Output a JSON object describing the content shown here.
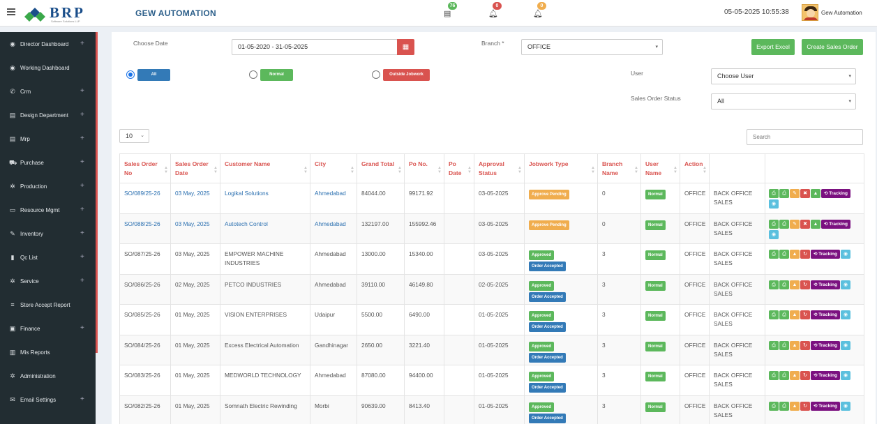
{
  "header": {
    "logo_text": "BRP",
    "logo_sub": "Software Solutions LLP",
    "app_title": "GEW AUTOMATION",
    "notifications": [
      {
        "icon": "message-icon",
        "count": "76",
        "color": "#5cb85c"
      },
      {
        "icon": "bell-icon",
        "count": "0",
        "color": "#d9534f"
      },
      {
        "icon": "bell-icon",
        "count": "0",
        "color": "#f0ad4e"
      }
    ],
    "datetime": "05-05-2025 10:55:38",
    "user_name": "Gew Automation"
  },
  "sidebar": {
    "items": [
      {
        "label": "Director Dashboard",
        "icon": "dashboard-icon",
        "expandable": true
      },
      {
        "label": "Working Dashboard",
        "icon": "dashboard-icon",
        "expandable": false
      },
      {
        "label": "Crm",
        "icon": "phone-icon",
        "expandable": true
      },
      {
        "label": "Design Department",
        "icon": "table-icon",
        "expandable": true
      },
      {
        "label": "Mrp",
        "icon": "table-icon",
        "expandable": true
      },
      {
        "label": "Purchase",
        "icon": "cart-icon",
        "expandable": true
      },
      {
        "label": "Production",
        "icon": "gear-icon",
        "expandable": true
      },
      {
        "label": "Resource Mgmt",
        "icon": "server-icon",
        "expandable": true
      },
      {
        "label": "Inventory",
        "icon": "wrench-icon",
        "expandable": true
      },
      {
        "label": "Qc List",
        "icon": "file-icon",
        "expandable": true
      },
      {
        "label": "Service",
        "icon": "gear-icon",
        "expandable": true
      },
      {
        "label": "Store Accept Report",
        "icon": "list-icon",
        "expandable": false
      },
      {
        "label": "Finance",
        "icon": "money-icon",
        "expandable": true
      },
      {
        "label": "Mis Reports",
        "icon": "bar-chart-icon",
        "expandable": false
      },
      {
        "label": "Administration",
        "icon": "gear-icon",
        "expandable": false
      },
      {
        "label": "Email Settings",
        "icon": "envelope-icon",
        "expandable": true
      }
    ]
  },
  "filters": {
    "choose_date_label": "Choose Date",
    "date_range": "01-05-2020 - 31-05-2025",
    "branch_label": "Branch *",
    "branch_value": "OFFICE",
    "export_label": "Export Excel",
    "create_label": "Create Sales Order",
    "radio_all": "All",
    "radio_normal": "Normal",
    "radio_outside": "Outside Jobwork",
    "user_label": "User",
    "user_value": "Choose User",
    "status_label": "Sales Order Status",
    "status_value": "All",
    "page_size": "10",
    "search_placeholder": "Search"
  },
  "table": {
    "headers": [
      "Sales Order No",
      "Sales Order Date",
      "Customer Name",
      "City",
      "Grand Total",
      "Po No.",
      "Po Date",
      "Approval Status",
      "Jobwork Type",
      "Branch Name",
      "User Name",
      "Action"
    ],
    "rows": [
      {
        "no": "SO/089/25-26",
        "date": "03 May, 2025",
        "customer": "Logikal Solutions",
        "city": "Ahmedabad",
        "total": "84044.00",
        "po_no": "99171.92",
        "po_date": "",
        "approval": "03-05-2025",
        "jobwork": [
          "Approve Pending"
        ],
        "branch": "0",
        "user": "Normal",
        "action": "OFFICE",
        "extra": "BACK OFFICE SALES",
        "pending": true
      },
      {
        "no": "SO/088/25-26",
        "date": "03 May, 2025",
        "customer": "Autotech Control",
        "city": "Ahmedabad",
        "total": "132197.00",
        "po_no": "155992.46",
        "po_date": "",
        "approval": "03-05-2025",
        "jobwork": [
          "Approve Pending"
        ],
        "branch": "0",
        "user": "Normal",
        "action": "OFFICE",
        "extra": "BACK OFFICE SALES",
        "pending": true
      },
      {
        "no": "SO/087/25-26",
        "date": "03 May, 2025",
        "customer": "EMPOWER MACHINE INDUSTRIES",
        "city": "Ahmedabad",
        "total": "13000.00",
        "po_no": "15340.00",
        "po_date": "",
        "approval": "03-05-2025",
        "jobwork": [
          "Approved",
          "Order Accepted"
        ],
        "branch": "3",
        "user": "Normal",
        "action": "OFFICE",
        "extra": "BACK OFFICE SALES",
        "pending": false
      },
      {
        "no": "SO/086/25-26",
        "date": "02 May, 2025",
        "customer": "PETCO INDUSTRIES",
        "city": "Ahmedabad",
        "total": "39110.00",
        "po_no": "46149.80",
        "po_date": "",
        "approval": "02-05-2025",
        "jobwork": [
          "Approved",
          "Order Accepted"
        ],
        "branch": "3",
        "user": "Normal",
        "action": "OFFICE",
        "extra": "BACK OFFICE SALES",
        "pending": false
      },
      {
        "no": "SO/085/25-26",
        "date": "01 May, 2025",
        "customer": "VISION ENTERPRISES",
        "city": "Udaipur",
        "total": "5500.00",
        "po_no": "6490.00",
        "po_date": "",
        "approval": "01-05-2025",
        "jobwork": [
          "Approved",
          "Order Accepted"
        ],
        "branch": "3",
        "user": "Normal",
        "action": "OFFICE",
        "extra": "BACK OFFICE SALES",
        "pending": false
      },
      {
        "no": "SO/084/25-26",
        "date": "01 May, 2025",
        "customer": "Excess Electrical Automation",
        "city": "Gandhinagar",
        "total": "2650.00",
        "po_no": "3221.40",
        "po_date": "",
        "approval": "01-05-2025",
        "jobwork": [
          "Approved",
          "Order Accepted"
        ],
        "branch": "3",
        "user": "Normal",
        "action": "OFFICE",
        "extra": "BACK OFFICE SALES",
        "pending": false
      },
      {
        "no": "SO/083/25-26",
        "date": "01 May, 2025",
        "customer": "MEDWORLD TECHNOLOGY",
        "city": "Ahmedabad",
        "total": "87080.00",
        "po_no": "94400.00",
        "po_date": "",
        "approval": "01-05-2025",
        "jobwork": [
          "Approved",
          "Order Accepted"
        ],
        "branch": "3",
        "user": "Normal",
        "action": "OFFICE",
        "extra": "BACK OFFICE SALES",
        "pending": false
      },
      {
        "no": "SO/082/25-26",
        "date": "01 May, 2025",
        "customer": "Somnath Electric Rewinding",
        "city": "Morbi",
        "total": "90639.00",
        "po_no": "8413.40",
        "po_date": "",
        "approval": "01-05-2025",
        "jobwork": [
          "Approved",
          "Order Accepted"
        ],
        "branch": "3",
        "user": "Normal",
        "action": "OFFICE",
        "extra": "BACK OFFICE SALES",
        "pending": false
      }
    ],
    "tracking_label": "Tracking"
  }
}
